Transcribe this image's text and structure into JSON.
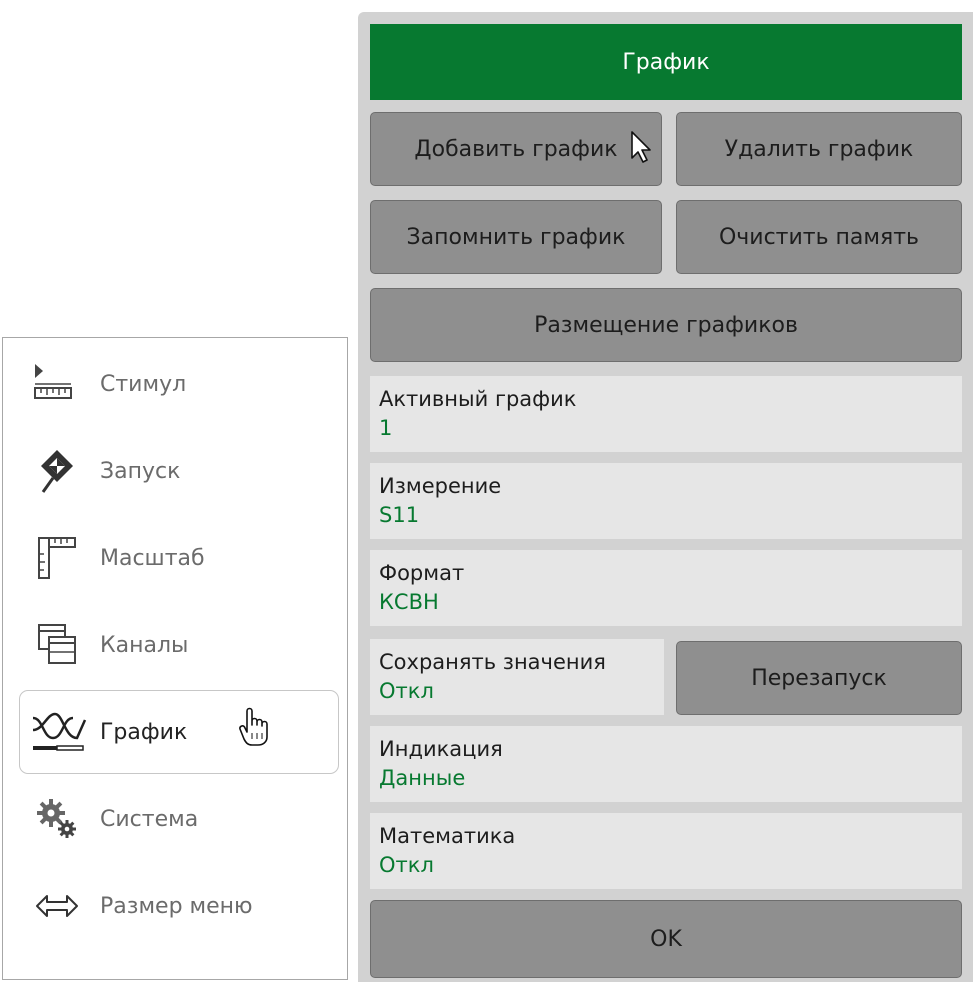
{
  "left_menu": {
    "items": [
      {
        "label": "Стимул",
        "icon": "ruler-arrow-icon"
      },
      {
        "label": "Запуск",
        "icon": "trigger-diamond-icon"
      },
      {
        "label": "Масштаб",
        "icon": "scale-ruler-icon"
      },
      {
        "label": "Каналы",
        "icon": "channels-windows-icon"
      },
      {
        "label": "График",
        "icon": "trace-wave-icon",
        "active": true
      },
      {
        "label": "Система",
        "icon": "gears-icon"
      },
      {
        "label": "Размер меню",
        "icon": "double-arrow-icon"
      }
    ]
  },
  "panel": {
    "title": "График",
    "buttons": {
      "add_trace": "Добавить график",
      "delete_trace": "Удалить график",
      "memorize_trace": "Запомнить график",
      "clear_memory": "Очистить память",
      "trace_layout": "Размещение графиков",
      "restart": "Перезапуск",
      "ok": "OK"
    },
    "fields": {
      "active_trace": {
        "label": "Активный график",
        "value": "1"
      },
      "measurement": {
        "label": "Измерение",
        "value": "S11"
      },
      "format": {
        "label": "Формат",
        "value": "КСВН"
      },
      "hold": {
        "label": "Сохранять значения",
        "value": "Откл"
      },
      "display": {
        "label": "Индикация",
        "value": "Данные"
      },
      "math": {
        "label": "Математика",
        "value": "Откл"
      }
    }
  },
  "colors": {
    "title_bar": "#077930",
    "value_text": "#077930",
    "button_bg": "#8f8f8f",
    "field_bg": "#e6e6e6",
    "panel_bg": "#d2d2d2"
  }
}
